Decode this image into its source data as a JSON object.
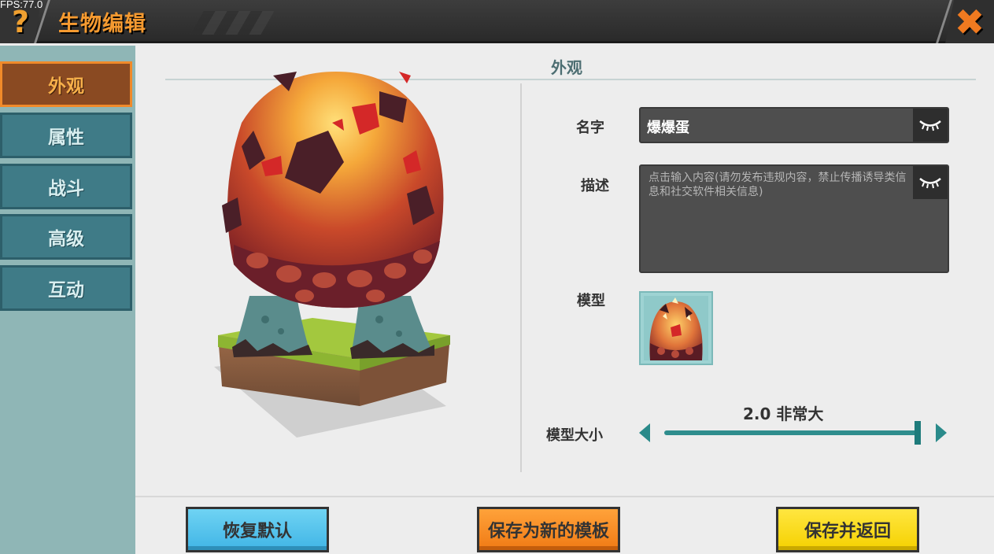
{
  "header": {
    "fps": "FPS:77.0",
    "help_icon": "question-mark-icon",
    "title": "生物编辑",
    "close_icon": "close-x-icon",
    "accent_color": "#f59a30"
  },
  "sidebar": {
    "items": [
      {
        "label": "外观",
        "active": true
      },
      {
        "label": "属性",
        "active": false
      },
      {
        "label": "战斗",
        "active": false
      },
      {
        "label": "高级",
        "active": false
      },
      {
        "label": "互动",
        "active": false
      }
    ]
  },
  "main": {
    "section_title": "外观",
    "name": {
      "label": "名字",
      "value": "爆爆蛋",
      "eye_icon": "eye-closed-icon"
    },
    "description": {
      "label": "描述",
      "placeholder": "点击输入内容(请勿发布违规内容，禁止传播诱导类信息和社交软件相关信息)",
      "eye_icon": "eye-closed-icon"
    },
    "model": {
      "label": "模型",
      "thumbnail_icon": "lava-egg-model-icon"
    },
    "model_size": {
      "label": "模型大小",
      "value_text": "2.0 非常大",
      "slider_fraction": 1.0
    }
  },
  "buttons": {
    "reset": "恢复默认",
    "save_template": "保存为新的模板",
    "save_return": "保存并返回"
  }
}
